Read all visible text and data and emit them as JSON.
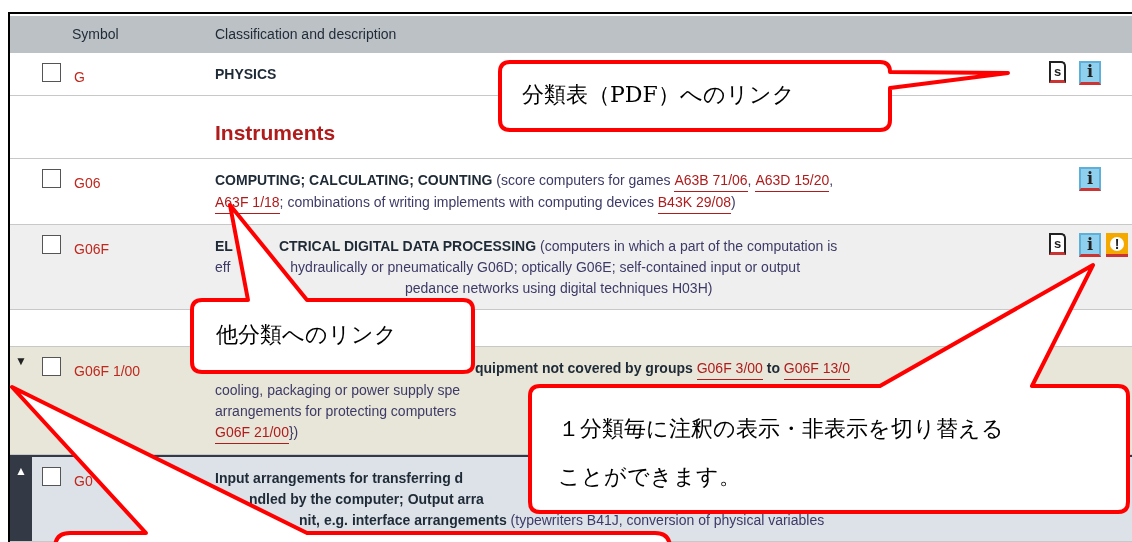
{
  "table": {
    "columns": [
      "Symbol",
      "Classification and description"
    ],
    "rows": [
      {
        "kind": "plain",
        "checked": false,
        "symbol": "G",
        "lines": [
          [
            {
              "text": "PHYSICS",
              "kind": "bold"
            }
          ]
        ],
        "icons": [
          {
            "kind": "scheme",
            "glyph": "s"
          },
          {
            "kind": "info",
            "glyph": "i"
          }
        ]
      },
      {
        "kind": "heading",
        "title": "Instruments"
      },
      {
        "kind": "plain",
        "checked": false,
        "symbol": "G06",
        "lines": [
          [
            {
              "text": "COMPUTING; CALCULATING; COUNTING",
              "kind": "bold"
            },
            {
              "text": " (score computers for games ",
              "kind": "plain"
            },
            {
              "text": "A63B 71/06",
              "kind": "link"
            },
            {
              "text": ", ",
              "kind": "plain"
            },
            {
              "text": "A63D 15/20",
              "kind": "link"
            },
            {
              "text": ",",
              "kind": "plain"
            }
          ],
          [
            {
              "text": "A63F 1/18",
              "kind": "link"
            },
            {
              "text": "; combinations of writing implements with computing devices ",
              "kind": "plain"
            },
            {
              "text": "B43K 29/08",
              "kind": "link"
            },
            {
              "text": ")",
              "kind": "plain"
            }
          ]
        ],
        "icons": [
          {
            "kind": "info",
            "glyph": "i"
          }
        ]
      },
      {
        "kind": "shaded",
        "checked": false,
        "symbol": "G06F",
        "lines": [
          [
            {
              "text": "EL",
              "kind": "bold"
            },
            {
              "text": "CTRICAL DIGITAL DATA PROCESSING",
              "kind": "bold"
            },
            {
              "text": " (computers in which a part of the computation is",
              "kind": "plain"
            }
          ],
          [
            {
              "text": "eff",
              "kind": "plain"
            },
            {
              "text": "hydraulically or pneumatically G06D; optically G06E; self-contained input or output",
              "kind": "plain"
            }
          ],
          [
            {
              "text": "pedance networks using digital techniques H03H)",
              "kind": "plain"
            }
          ]
        ],
        "icons": [
          {
            "kind": "scheme",
            "glyph": "s"
          },
          {
            "kind": "info",
            "glyph": "i"
          },
          {
            "kind": "warning",
            "glyph": "!"
          }
        ]
      },
      {
        "kind": "spacer"
      },
      {
        "kind": "note",
        "checked": false,
        "toggle": "▼",
        "symbol": "G06F 1/00",
        "lines": [
          [
            {
              "text": "quipment not covered by groups ",
              "kind": "bold"
            },
            {
              "text": "G06F 3/00",
              "kind": "link"
            },
            {
              "text": " to ",
              "kind": "bold"
            },
            {
              "text": "G06F 13/0",
              "kind": "link"
            }
          ],
          [
            {
              "text": "cooling, packaging or power supply spe",
              "kind": "plain"
            }
          ],
          [
            {
              "text": "arrangements for protecting computers",
              "kind": "plain"
            }
          ],
          [
            {
              "text": "G06F 21/00",
              "kind": "link"
            },
            {
              "text": "})",
              "kind": "plain"
            }
          ]
        ],
        "icons": []
      },
      {
        "kind": "current",
        "checked": false,
        "toggle": "▲",
        "symbol": "G0",
        "lines": [
          [
            {
              "text": "Input arrangements for transferring d",
              "kind": "bold"
            }
          ],
          [
            {
              "text": "ndled by the computer; Output arra",
              "kind": "bold"
            }
          ],
          [
            {
              "text": "nit, e.g. interface arrangements",
              "kind": "bold"
            },
            {
              "text": " (typewriters B41J, conversion of physical variables",
              "kind": "plain"
            }
          ]
        ],
        "icons": []
      }
    ]
  },
  "callouts": [
    {
      "lines": [
        "分類表（PDF）へのリンク"
      ]
    },
    {
      "lines": [
        "他分類へのリンク"
      ]
    },
    {
      "lines": [
        "１分類毎に注釈の表示・非表示を切り替える",
        "ことができます。"
      ]
    }
  ]
}
